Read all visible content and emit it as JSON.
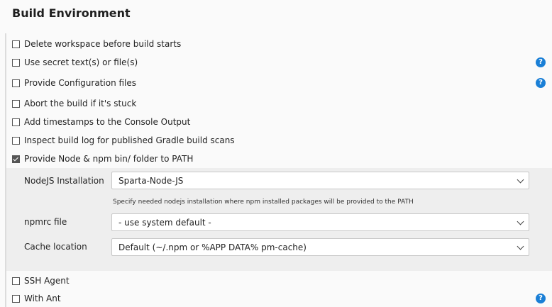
{
  "section": {
    "title": "Build Environment"
  },
  "options": [
    {
      "label": "Delete workspace before build starts",
      "checked": false,
      "help": false
    },
    {
      "label": "Use secret text(s) or file(s)",
      "checked": false,
      "help": true
    },
    {
      "label": "Provide Configuration files",
      "checked": false,
      "help": true
    },
    {
      "label": "Abort the build if it's stuck",
      "checked": false,
      "help": false
    },
    {
      "label": "Add timestamps to the Console Output",
      "checked": false,
      "help": false
    },
    {
      "label": "Inspect build log for published Gradle build scans",
      "checked": false,
      "help": false
    },
    {
      "label": "Provide Node & npm bin/ folder to PATH",
      "checked": true,
      "help": false
    },
    {
      "label": "SSH Agent",
      "checked": false,
      "help": false
    },
    {
      "label": "With Ant",
      "checked": false,
      "help": true
    }
  ],
  "node_config": {
    "nodejs_label": "NodeJS Installation",
    "nodejs_value": "Sparta-Node-JS",
    "nodejs_hint": "Specify needed nodejs installation where npm installed packages will be provided to the PATH",
    "npmrc_label": "npmrc file",
    "npmrc_value": "- use system default -",
    "cache_label": "Cache location",
    "cache_value": "Default (~/.npm or %APP DATA% pm-cache)"
  },
  "help_glyph": "?",
  "colors": {
    "help_icon": "#1a7fd6",
    "nested_background": "#eeeeee"
  }
}
